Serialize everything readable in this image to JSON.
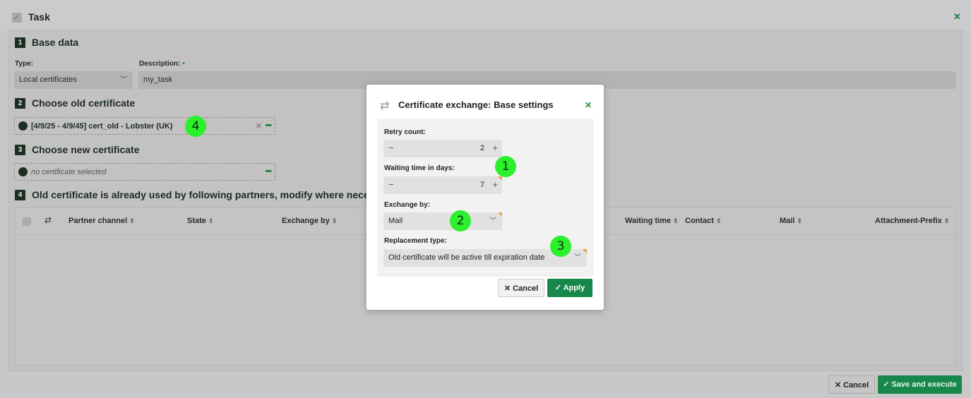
{
  "task": {
    "title": "Task",
    "close_icon": "close-icon"
  },
  "base_data": {
    "step": "1",
    "title": "Base data",
    "type_label": "Type:",
    "type_value": "Local certificates",
    "description_label": "Description:",
    "description_required": "•",
    "description_value": "my_task"
  },
  "old_cert": {
    "step": "2",
    "title": "Choose old certificate",
    "value": "[4/9/25 - 4/9/45] cert_old - Lobster (UK)"
  },
  "new_cert": {
    "step": "3",
    "title": "Choose new certificate",
    "placeholder": "no certificate selected"
  },
  "partners": {
    "step": "4",
    "title": "Old certificate is already used by following partners, modify where necessary",
    "columns": [
      "Partner channel",
      "State",
      "Exchange by",
      "Waiting time",
      "Contact",
      "Mail",
      "Attachment-Prefix"
    ]
  },
  "footer": {
    "cancel_label": "Cancel",
    "save_label": "Save and execute"
  },
  "modal": {
    "title": "Certificate exchange: Base settings",
    "retry_label": "Retry count:",
    "retry_value": "2",
    "waiting_label": "Waiting time in days:",
    "waiting_value": "7",
    "exchange_label": "Exchange by:",
    "exchange_value": "Mail",
    "replacement_label": "Replacement type:",
    "replacement_value": "Old certificate will be active till expiration date",
    "cancel_label": "Cancel",
    "apply_label": "Apply"
  },
  "badges": [
    "1",
    "2",
    "3",
    "4"
  ],
  "colors": {
    "accent": "#17874a",
    "badge": "#2cf02c",
    "modified_corner": "#e6a64a"
  }
}
